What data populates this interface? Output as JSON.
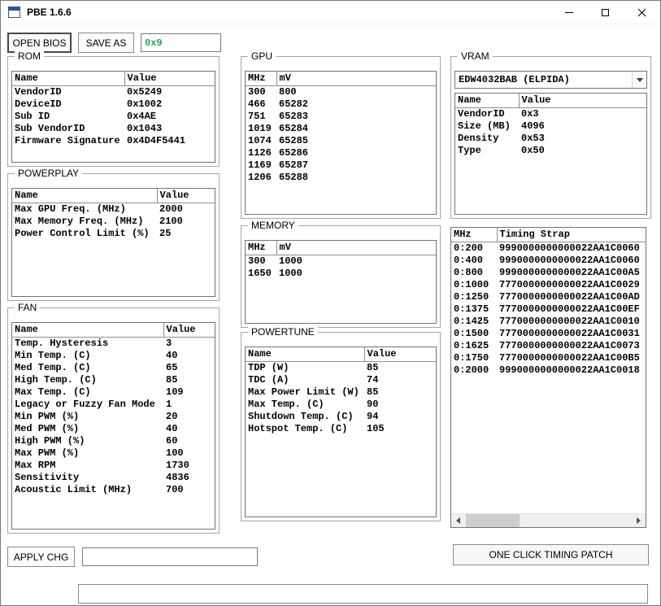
{
  "window": {
    "title": "PBE 1.6.6"
  },
  "toolbar": {
    "open_bios": "OPEN BIOS",
    "save_as": "SAVE AS",
    "version_value": "0x9"
  },
  "groups": {
    "rom": {
      "title": "ROM",
      "headers": [
        "Name",
        "Value"
      ],
      "rows": [
        [
          "VendorID",
          "0x5249"
        ],
        [
          "DeviceID",
          "0x1002"
        ],
        [
          "Sub ID",
          "0x4AE"
        ],
        [
          "Sub VendorID",
          "0x1043"
        ],
        [
          "Firmware Signature",
          "0x4D4F5441"
        ]
      ]
    },
    "powerplay": {
      "title": "POWERPLAY",
      "headers": [
        "Name",
        "Value"
      ],
      "rows": [
        [
          "Max GPU Freq. (MHz)",
          "2000"
        ],
        [
          "Max Memory Freq. (MHz)",
          "2100"
        ],
        [
          "Power Control Limit (%)",
          "25"
        ]
      ]
    },
    "fan": {
      "title": "FAN",
      "headers": [
        "Name",
        "Value"
      ],
      "rows": [
        [
          "Temp. Hysteresis",
          "3"
        ],
        [
          "Min Temp. (C)",
          "40"
        ],
        [
          "Med Temp. (C)",
          "65"
        ],
        [
          "High Temp. (C)",
          "85"
        ],
        [
          "Max Temp. (C)",
          "109"
        ],
        [
          "Legacy or Fuzzy Fan Mode",
          "1"
        ],
        [
          "Min PWM (%)",
          "20"
        ],
        [
          "Med PWM (%)",
          "40"
        ],
        [
          "High PWM (%)",
          "60"
        ],
        [
          "Max PWM (%)",
          "100"
        ],
        [
          "Max RPM",
          "1730"
        ],
        [
          "Sensitivity",
          "4836"
        ],
        [
          "Acoustic Limit (MHz)",
          "700"
        ]
      ]
    },
    "gpu": {
      "title": "GPU",
      "headers": [
        "MHz",
        "mV"
      ],
      "rows": [
        [
          "300",
          "800"
        ],
        [
          "466",
          "65282"
        ],
        [
          "751",
          "65283"
        ],
        [
          "1019",
          "65284"
        ],
        [
          "1074",
          "65285"
        ],
        [
          "1126",
          "65286"
        ],
        [
          "1169",
          "65287"
        ],
        [
          "1206",
          "65288"
        ]
      ]
    },
    "memory": {
      "title": "MEMORY",
      "headers": [
        "MHz",
        "mV"
      ],
      "rows": [
        [
          "300",
          "1000"
        ],
        [
          "1650",
          "1000"
        ]
      ]
    },
    "powertune": {
      "title": "POWERTUNE",
      "headers": [
        "Name",
        "Value"
      ],
      "rows": [
        [
          "TDP (W)",
          "85"
        ],
        [
          "TDC (A)",
          "74"
        ],
        [
          "Max Power Limit (W)",
          "85"
        ],
        [
          "Max Temp. (C)",
          "90"
        ],
        [
          "Shutdown Temp. (C)",
          "94"
        ],
        [
          "Hotspot Temp. (C)",
          "105"
        ]
      ]
    },
    "vram": {
      "title": "VRAM",
      "selected": "EDW4032BAB (ELPIDA)",
      "headers": [
        "Name",
        "Value"
      ],
      "rows": [
        [
          "VendorID",
          "0x3"
        ],
        [
          "Size (MB)",
          "4096"
        ],
        [
          "Density",
          "0x53"
        ],
        [
          "Type",
          "0x50"
        ]
      ]
    }
  },
  "timing": {
    "headers": [
      "MHz",
      "Timing Strap"
    ],
    "rows": [
      [
        "0:200",
        "9990000000000022AA1C0060"
      ],
      [
        "0:400",
        "9990000000000022AA1C0060"
      ],
      [
        "0:800",
        "9990000000000022AA1C00A5"
      ],
      [
        "0:1000",
        "7770000000000022AA1C0029"
      ],
      [
        "0:1250",
        "7770000000000022AA1C00AD"
      ],
      [
        "0:1375",
        "7770000000000022AA1C00EF"
      ],
      [
        "0:1425",
        "7770000000000022AA1C0010"
      ],
      [
        "0:1500",
        "7770000000000022AA1C0031"
      ],
      [
        "0:1625",
        "7770000000000022AA1C0073"
      ],
      [
        "0:1750",
        "7770000000000022AA1C00B5"
      ],
      [
        "0:2000",
        "9990000000000022AA1C0018"
      ]
    ]
  },
  "bottom": {
    "apply_chg": "APPLY CHG",
    "command_value": "",
    "one_click": "ONE CLICK TIMING PATCH"
  },
  "colors": {
    "version_text": "#2e9e57",
    "window_bg": "#ffffff"
  }
}
